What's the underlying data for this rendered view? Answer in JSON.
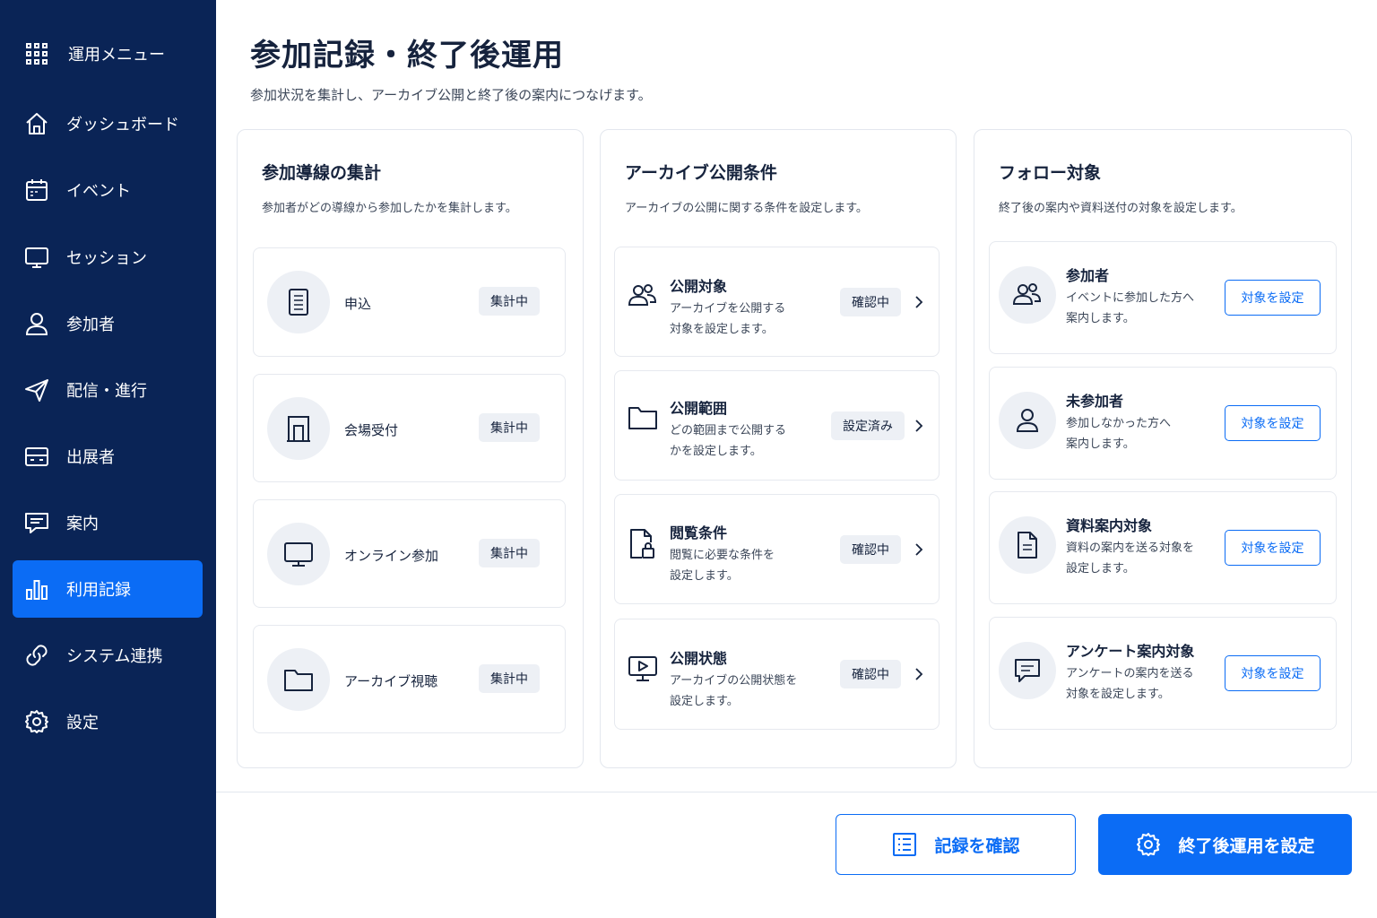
{
  "sidebar": {
    "header": {
      "label": "運用メニュー",
      "icon": "grid-icon"
    },
    "items": [
      {
        "label": "ダッシュボード",
        "icon": "home-icon",
        "active": false
      },
      {
        "label": "イベント",
        "icon": "calendar-icon",
        "active": false
      },
      {
        "label": "セッション",
        "icon": "monitor-icon",
        "active": false
      },
      {
        "label": "参加者",
        "icon": "user-icon",
        "active": false
      },
      {
        "label": "配信・進行",
        "icon": "send-icon",
        "active": false
      },
      {
        "label": "出展者",
        "icon": "booth-icon",
        "active": false
      },
      {
        "label": "案内",
        "icon": "message-icon",
        "active": false
      },
      {
        "label": "利用記録",
        "icon": "bar-chart-icon",
        "active": true
      },
      {
        "label": "システム連携",
        "icon": "link-icon",
        "active": false
      },
      {
        "label": "設定",
        "icon": "gear-icon",
        "active": false
      }
    ]
  },
  "page": {
    "title": "参加記録・終了後運用",
    "subtitle": "参加状況を集計し、アーカイブ公開と終了後の案内につなげます。"
  },
  "panels": {
    "channels": {
      "title": "参加導線の集計",
      "desc": "参加者がどの導線から参加したかを集計します。",
      "items": [
        {
          "label": "申込",
          "status": "集計中",
          "icon": "document-icon"
        },
        {
          "label": "会場受付",
          "status": "集計中",
          "icon": "building-icon"
        },
        {
          "label": "オンライン参加",
          "status": "集計中",
          "icon": "monitor-icon"
        },
        {
          "label": "アーカイブ視聴",
          "status": "集計中",
          "icon": "folder-icon"
        }
      ]
    },
    "archive": {
      "title": "アーカイブ公開条件",
      "desc": "アーカイブの公開に関する条件を設定します。",
      "items": [
        {
          "title": "公開対象",
          "desc": "アーカイブを公開する\n対象を設定します。",
          "status": "確認中",
          "icon": "users-icon"
        },
        {
          "title": "公開範囲",
          "desc": "どの範囲まで公開する\nかを設定します。",
          "status": "設定済み",
          "icon": "folder-icon"
        },
        {
          "title": "閲覧条件",
          "desc": "閲覧に必要な条件を\n設定します。",
          "status": "確認中",
          "icon": "lock-document-icon"
        },
        {
          "title": "公開状態",
          "desc": "アーカイブの公開状態を\n設定します。",
          "status": "確認中",
          "icon": "play-monitor-icon"
        }
      ]
    },
    "follow": {
      "title": "フォロー対象",
      "desc": "終了後の案内や資料送付の対象を設定します。",
      "button_label": "対象を設定",
      "items": [
        {
          "title": "参加者",
          "desc": "イベントに参加した方へ\n案内します。",
          "icon": "users-icon"
        },
        {
          "title": "未参加者",
          "desc": "参加しなかった方へ\n案内します。",
          "icon": "user-icon"
        },
        {
          "title": "資料案内対象",
          "desc": "資料の案内を送る対象を\n設定します。",
          "icon": "document-icon"
        },
        {
          "title": "アンケート案内対象",
          "desc": "アンケートの案内を送る\n対象を設定します。",
          "icon": "chat-icon"
        }
      ]
    }
  },
  "footer": {
    "secondary_label": "記録を確認",
    "primary_label": "終了後運用を設定"
  },
  "colors": {
    "sidebar_bg": "#0a2456",
    "accent": "#0b6cf5",
    "icon_bg": "#edf0f5"
  }
}
